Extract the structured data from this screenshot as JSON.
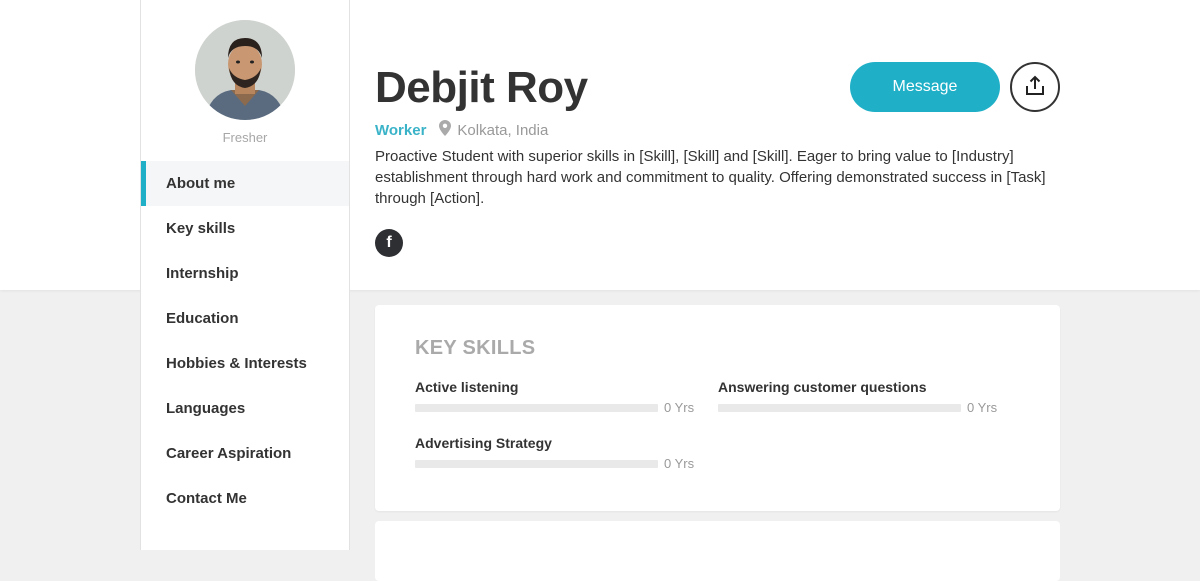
{
  "profile": {
    "name": "Debjit Roy",
    "status": "Fresher",
    "job_title": "Worker",
    "location": "Kolkata, India",
    "bio": "Proactive Student with superior skills in [Skill], [Skill] and [Skill]. Eager to bring value to [Industry] establishment through hard work and commitment to quality. Offering demonstrated success in [Task] through [Action].",
    "social": [
      {
        "icon": "facebook-icon",
        "label": "f"
      }
    ]
  },
  "actions": {
    "message_label": "Message",
    "share_icon": "share-upload-icon"
  },
  "sidebar": {
    "items": [
      {
        "label": "About me",
        "active": true
      },
      {
        "label": "Key skills",
        "active": false
      },
      {
        "label": "Internship",
        "active": false
      },
      {
        "label": "Education",
        "active": false
      },
      {
        "label": "Hobbies & Interests",
        "active": false
      },
      {
        "label": "Languages",
        "active": false
      },
      {
        "label": "Career Aspiration",
        "active": false
      },
      {
        "label": "Contact Me",
        "active": false
      }
    ]
  },
  "key_skills": {
    "title": "KEY SKILLS",
    "items": [
      {
        "name": "Active listening",
        "years": "0 Yrs",
        "level": 0
      },
      {
        "name": "Answering customer questions",
        "years": "0 Yrs",
        "level": 0
      },
      {
        "name": "Advertising Strategy",
        "years": "0 Yrs",
        "level": 0
      }
    ]
  },
  "colors": {
    "accent": "#1fb0c8",
    "text": "#333333",
    "muted": "#999999",
    "background": "#f0f0f0"
  }
}
